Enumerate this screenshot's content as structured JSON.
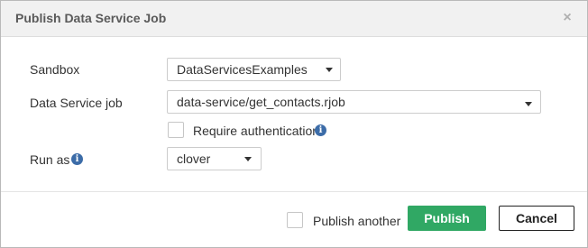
{
  "dialog": {
    "title": "Publish Data Service Job",
    "close_glyph": "×"
  },
  "form": {
    "sandbox_label": "Sandbox",
    "sandbox_value": "DataServicesExamples",
    "job_label": "Data Service job",
    "job_value": "data-service/get_contacts.rjob",
    "require_auth_label": "Require authentication",
    "require_auth_checked": false,
    "run_as_label": "Run as",
    "run_as_value": "clover",
    "info_glyph": "i"
  },
  "footer": {
    "publish_another_label": "Publish another",
    "publish_another_checked": false,
    "publish_label": "Publish",
    "cancel_label": "Cancel"
  },
  "colors": {
    "publish_button": "#30a864",
    "info_icon": "#3c6ca8",
    "header_bg": "#f1f1f1"
  }
}
